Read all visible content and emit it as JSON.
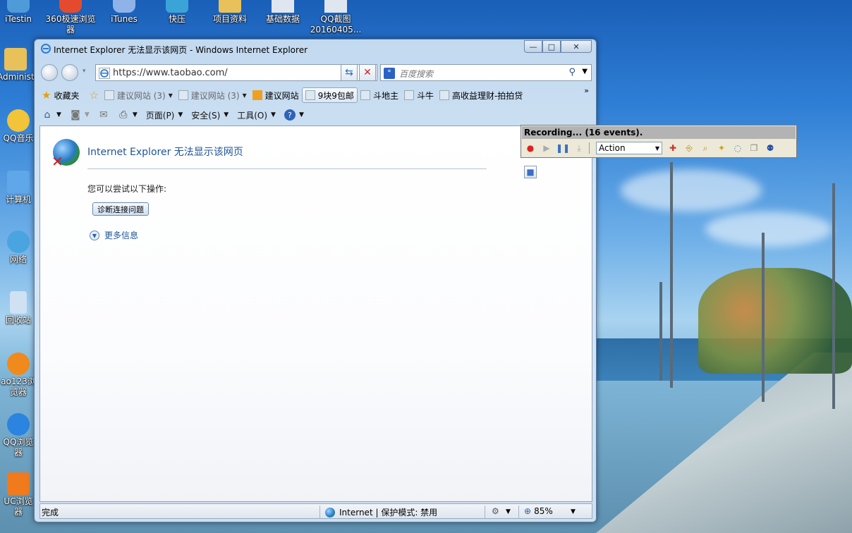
{
  "desktop": {
    "icons_top": [
      {
        "label": "iTestin",
        "color": "#4f9ad8"
      },
      {
        "label": "360极速浏览器",
        "color": "#e44b2e"
      },
      {
        "label": "iTunes",
        "color": "#8fb3e8"
      },
      {
        "label": "快压",
        "color": "#3aa3d8"
      },
      {
        "label": "项目资料",
        "color": "#e8c15a"
      },
      {
        "label": "基础数据",
        "color": "#dfe6ef"
      },
      {
        "label": "QQ截图20160405...",
        "color": "#dfe6ef"
      }
    ],
    "icons_left": [
      {
        "label": "Administr",
        "color": "#e8c15a"
      },
      {
        "label": "QQ音乐",
        "color": "#f2c43a"
      },
      {
        "label": "计算机",
        "color": "#5fa7e8"
      },
      {
        "label": "网络",
        "color": "#4aa4e0"
      },
      {
        "label": "回收站",
        "color": "#cfe1f2"
      },
      {
        "label": "ao123浏览器",
        "color": "#f08a1c"
      },
      {
        "label": "QQ浏览器",
        "color": "#2a84e0"
      },
      {
        "label": "UC浏览器",
        "color": "#f07a1c"
      }
    ]
  },
  "window": {
    "title": "Internet Explorer 无法显示该网页 - Windows Internet Explorer",
    "min": "—",
    "max": "□",
    "close": "✕"
  },
  "address": {
    "url": "https://www.taobao.com/",
    "refresh_glyph": "⇆",
    "stop_glyph": "✕"
  },
  "search": {
    "placeholder": "百度搜索"
  },
  "favorites": {
    "label": "收藏夹",
    "items": [
      {
        "label": "建议网站 (3)",
        "dim": true,
        "arrow": "▾"
      },
      {
        "label": "建议网站 (3)",
        "dim": true,
        "arrow": "▾"
      },
      {
        "label": "建议网站",
        "dim": false,
        "arrow": ""
      },
      {
        "label": "9块9包邮",
        "dim": false,
        "arrow": ""
      },
      {
        "label": "斗地主",
        "dim": false,
        "arrow": ""
      },
      {
        "label": "斗牛",
        "dim": false,
        "arrow": ""
      },
      {
        "label": "高收益理财-拍拍贷",
        "dim": false,
        "arrow": ""
      }
    ],
    "more": "»"
  },
  "commandbar": {
    "page": "页面(P)",
    "safety": "安全(S)",
    "tools": "工具(O)"
  },
  "error": {
    "title": "Internet Explorer 无法显示该网页",
    "sub": "您可以尝试以下操作:",
    "diag_button": "诊断连接问题",
    "more_info": "更多信息"
  },
  "status": {
    "done": "完成",
    "zone": "Internet | 保护模式: 禁用",
    "zoom": "85%"
  },
  "recorder": {
    "title": "Recording... (16 events).",
    "action": "Action"
  }
}
